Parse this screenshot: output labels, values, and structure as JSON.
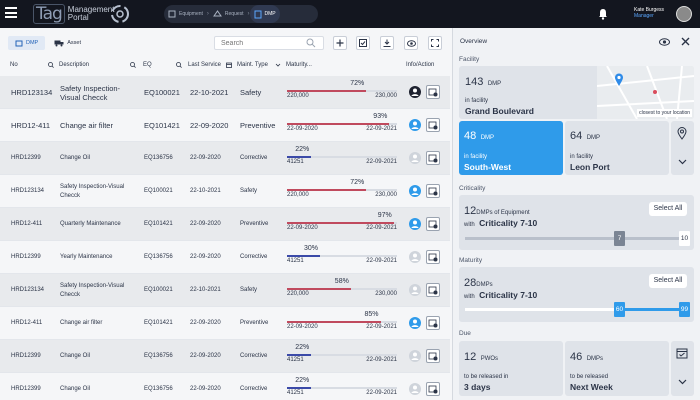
{
  "header": {
    "logo_tag": "Tag",
    "logo_line1": "Management",
    "logo_line2": "Portal",
    "breadcrumbs": [
      "Equipment",
      "Request",
      "DMP"
    ],
    "user_name": "Kate Burgess",
    "user_role": "Manager"
  },
  "toolbar": {
    "tabs": [
      "DMP",
      "Asset"
    ],
    "search_placeholder": "Search"
  },
  "table": {
    "columns": [
      "No",
      "Description",
      "EQ",
      "Last Service",
      "Maint. Type",
      "Maturity...",
      "Info/Action"
    ],
    "rows": [
      {
        "no": "HRD123134",
        "desc": "Safety Inspection-Visual Checck",
        "eq": "EQ100021",
        "last": "22-10-2021",
        "type": "Safety",
        "pct": "72%",
        "lo": "220,000",
        "hi": "230,000",
        "color": "#c04a5e"
      },
      {
        "no": "HRD12-411",
        "desc": "Change air filter",
        "eq": "EQ101421",
        "last": "22-09-2020",
        "type": "Preventive",
        "pct": "93%",
        "lo": "22-09-2020",
        "hi": "22-09-2021",
        "color": "#c04a5e"
      },
      {
        "no": "HRD12399",
        "desc": "Change Oil",
        "eq": "EQ136756",
        "last": "22-09-2020",
        "type": "Corrective",
        "pct": "22%",
        "lo": "41251",
        "hi": "22-09-2021",
        "color": "#3b4aa8"
      },
      {
        "no": "HRD123134",
        "desc": "Safety Inspection-Visual Checck",
        "eq": "EQ100021",
        "last": "22-10-2021",
        "type": "Safety",
        "pct": "72%",
        "lo": "220,000",
        "hi": "230,000",
        "color": "#c04a5e"
      },
      {
        "no": "HRD12-411",
        "desc": "Quarterly Maintenance",
        "eq": "EQ101421",
        "last": "22-09-2020",
        "type": "Preventive",
        "pct": "97%",
        "lo": "22-09-2020",
        "hi": "22-09-2021",
        "color": "#c04a5e"
      },
      {
        "no": "HRD12399",
        "desc": "Yearly Maintenance",
        "eq": "EQ136756",
        "last": "22-09-2020",
        "type": "Corrective",
        "pct": "30%",
        "lo": "41251",
        "hi": "22-09-2021",
        "color": "#3b4aa8"
      },
      {
        "no": "HRD123134",
        "desc": "Safety Inspection-Visual Checck",
        "eq": "EQ100021",
        "last": "22-10-2021",
        "type": "Safety",
        "pct": "58%",
        "lo": "220,000",
        "hi": "230,000",
        "color": "#c04a5e"
      },
      {
        "no": "HRD12-411",
        "desc": "Change air filter",
        "eq": "EQ101421",
        "last": "22-09-2020",
        "type": "Preventive",
        "pct": "85%",
        "lo": "22-09-2020",
        "hi": "22-09-2021",
        "color": "#c04a5e"
      },
      {
        "no": "HRD12399",
        "desc": "Change Oil",
        "eq": "EQ136756",
        "last": "22-09-2020",
        "type": "Corrective",
        "pct": "22%",
        "lo": "41251",
        "hi": "22-09-2021",
        "color": "#3b4aa8"
      },
      {
        "no": "HRD12399",
        "desc": "Change Oil",
        "eq": "EQ136756",
        "last": "22-09-2020",
        "type": "Corrective",
        "pct": "22%",
        "lo": "41251",
        "hi": "22-09-2021",
        "color": "#3b4aa8"
      }
    ]
  },
  "overview": {
    "title": "Overview",
    "facility_label": "Facility",
    "facility_count": "143",
    "facility_unit": "DMP",
    "facility_in": "in facility",
    "facility_name": "Grand Boulevard",
    "map_caption": "closest to your location",
    "sw_count": "48",
    "sw_unit": "DMP",
    "sw_in": "in facility",
    "sw_name": "South-West",
    "lp_count": "64",
    "lp_unit": "DMP",
    "lp_in": "in facility",
    "lp_name": "Leon Port",
    "criticality_label": "Criticality",
    "crit_count": "12",
    "crit_unit": "DMPs of Equipment",
    "crit_with": "with",
    "crit_range": "Criticality 7-10",
    "crit_selectall": "Select All",
    "crit_min": "7",
    "crit_max": "10",
    "maturity_label": "Maturity",
    "mat_count": "28",
    "mat_unit": "DMPs",
    "mat_with": "with",
    "mat_range": "Criticality 7-10",
    "mat_selectall": "Select All",
    "mat_min": "60",
    "mat_max": "99",
    "due_label": "Due",
    "due1_count": "12",
    "due1_unit": "PWOs",
    "due1_text": "to be released in",
    "due1_when": "3 days",
    "due2_count": "46",
    "due2_unit": "DMPs",
    "due2_text": "to be released",
    "due2_when": "Next  Week"
  }
}
